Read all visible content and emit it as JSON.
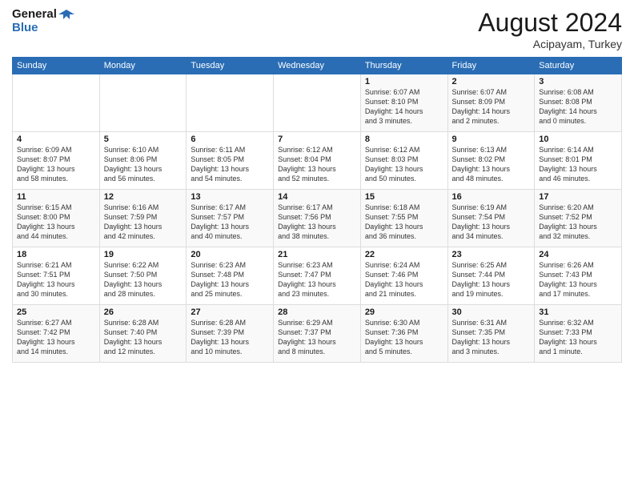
{
  "logo": {
    "line1": "General",
    "line2": "Blue"
  },
  "title": {
    "month_year": "August 2024",
    "location": "Acipayam, Turkey"
  },
  "weekdays": [
    "Sunday",
    "Monday",
    "Tuesday",
    "Wednesday",
    "Thursday",
    "Friday",
    "Saturday"
  ],
  "weeks": [
    [
      {
        "day": "",
        "info": ""
      },
      {
        "day": "",
        "info": ""
      },
      {
        "day": "",
        "info": ""
      },
      {
        "day": "",
        "info": ""
      },
      {
        "day": "1",
        "info": "Sunrise: 6:07 AM\nSunset: 8:10 PM\nDaylight: 14 hours\nand 3 minutes."
      },
      {
        "day": "2",
        "info": "Sunrise: 6:07 AM\nSunset: 8:09 PM\nDaylight: 14 hours\nand 2 minutes."
      },
      {
        "day": "3",
        "info": "Sunrise: 6:08 AM\nSunset: 8:08 PM\nDaylight: 14 hours\nand 0 minutes."
      }
    ],
    [
      {
        "day": "4",
        "info": "Sunrise: 6:09 AM\nSunset: 8:07 PM\nDaylight: 13 hours\nand 58 minutes."
      },
      {
        "day": "5",
        "info": "Sunrise: 6:10 AM\nSunset: 8:06 PM\nDaylight: 13 hours\nand 56 minutes."
      },
      {
        "day": "6",
        "info": "Sunrise: 6:11 AM\nSunset: 8:05 PM\nDaylight: 13 hours\nand 54 minutes."
      },
      {
        "day": "7",
        "info": "Sunrise: 6:12 AM\nSunset: 8:04 PM\nDaylight: 13 hours\nand 52 minutes."
      },
      {
        "day": "8",
        "info": "Sunrise: 6:12 AM\nSunset: 8:03 PM\nDaylight: 13 hours\nand 50 minutes."
      },
      {
        "day": "9",
        "info": "Sunrise: 6:13 AM\nSunset: 8:02 PM\nDaylight: 13 hours\nand 48 minutes."
      },
      {
        "day": "10",
        "info": "Sunrise: 6:14 AM\nSunset: 8:01 PM\nDaylight: 13 hours\nand 46 minutes."
      }
    ],
    [
      {
        "day": "11",
        "info": "Sunrise: 6:15 AM\nSunset: 8:00 PM\nDaylight: 13 hours\nand 44 minutes."
      },
      {
        "day": "12",
        "info": "Sunrise: 6:16 AM\nSunset: 7:59 PM\nDaylight: 13 hours\nand 42 minutes."
      },
      {
        "day": "13",
        "info": "Sunrise: 6:17 AM\nSunset: 7:57 PM\nDaylight: 13 hours\nand 40 minutes."
      },
      {
        "day": "14",
        "info": "Sunrise: 6:17 AM\nSunset: 7:56 PM\nDaylight: 13 hours\nand 38 minutes."
      },
      {
        "day": "15",
        "info": "Sunrise: 6:18 AM\nSunset: 7:55 PM\nDaylight: 13 hours\nand 36 minutes."
      },
      {
        "day": "16",
        "info": "Sunrise: 6:19 AM\nSunset: 7:54 PM\nDaylight: 13 hours\nand 34 minutes."
      },
      {
        "day": "17",
        "info": "Sunrise: 6:20 AM\nSunset: 7:52 PM\nDaylight: 13 hours\nand 32 minutes."
      }
    ],
    [
      {
        "day": "18",
        "info": "Sunrise: 6:21 AM\nSunset: 7:51 PM\nDaylight: 13 hours\nand 30 minutes."
      },
      {
        "day": "19",
        "info": "Sunrise: 6:22 AM\nSunset: 7:50 PM\nDaylight: 13 hours\nand 28 minutes."
      },
      {
        "day": "20",
        "info": "Sunrise: 6:23 AM\nSunset: 7:48 PM\nDaylight: 13 hours\nand 25 minutes."
      },
      {
        "day": "21",
        "info": "Sunrise: 6:23 AM\nSunset: 7:47 PM\nDaylight: 13 hours\nand 23 minutes."
      },
      {
        "day": "22",
        "info": "Sunrise: 6:24 AM\nSunset: 7:46 PM\nDaylight: 13 hours\nand 21 minutes."
      },
      {
        "day": "23",
        "info": "Sunrise: 6:25 AM\nSunset: 7:44 PM\nDaylight: 13 hours\nand 19 minutes."
      },
      {
        "day": "24",
        "info": "Sunrise: 6:26 AM\nSunset: 7:43 PM\nDaylight: 13 hours\nand 17 minutes."
      }
    ],
    [
      {
        "day": "25",
        "info": "Sunrise: 6:27 AM\nSunset: 7:42 PM\nDaylight: 13 hours\nand 14 minutes."
      },
      {
        "day": "26",
        "info": "Sunrise: 6:28 AM\nSunset: 7:40 PM\nDaylight: 13 hours\nand 12 minutes."
      },
      {
        "day": "27",
        "info": "Sunrise: 6:28 AM\nSunset: 7:39 PM\nDaylight: 13 hours\nand 10 minutes."
      },
      {
        "day": "28",
        "info": "Sunrise: 6:29 AM\nSunset: 7:37 PM\nDaylight: 13 hours\nand 8 minutes."
      },
      {
        "day": "29",
        "info": "Sunrise: 6:30 AM\nSunset: 7:36 PM\nDaylight: 13 hours\nand 5 minutes."
      },
      {
        "day": "30",
        "info": "Sunrise: 6:31 AM\nSunset: 7:35 PM\nDaylight: 13 hours\nand 3 minutes."
      },
      {
        "day": "31",
        "info": "Sunrise: 6:32 AM\nSunset: 7:33 PM\nDaylight: 13 hours\nand 1 minute."
      }
    ]
  ]
}
